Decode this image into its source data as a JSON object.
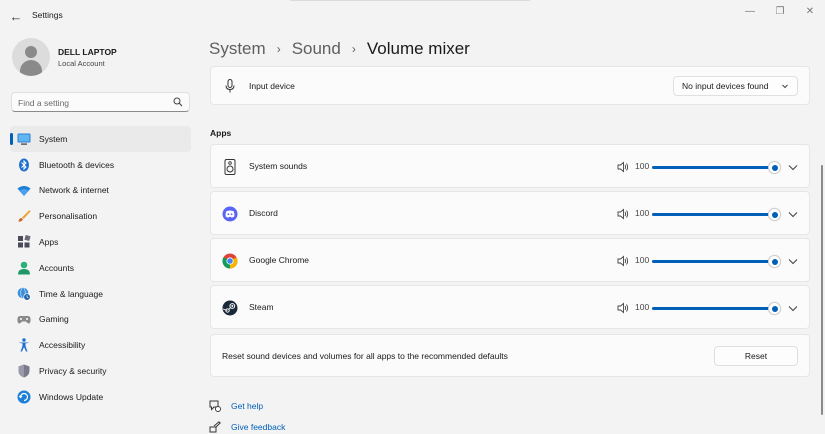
{
  "window": {
    "title": "Settings",
    "back_glyph": "←",
    "minimize_glyph": "—",
    "maximize_glyph": "❐",
    "close_glyph": "✕"
  },
  "profile": {
    "name": "DELL LAPTOP",
    "subtitle": "Local Account"
  },
  "search": {
    "placeholder": "Find a setting"
  },
  "sidebar": {
    "items": [
      {
        "label": "System",
        "icon": "system-icon",
        "active": true
      },
      {
        "label": "Bluetooth & devices",
        "icon": "bluetooth-icon"
      },
      {
        "label": "Network & internet",
        "icon": "wifi-icon"
      },
      {
        "label": "Personalisation",
        "icon": "brush-icon"
      },
      {
        "label": "Apps",
        "icon": "apps-icon"
      },
      {
        "label": "Accounts",
        "icon": "account-icon"
      },
      {
        "label": "Time & language",
        "icon": "globe-clock-icon"
      },
      {
        "label": "Gaming",
        "icon": "controller-icon"
      },
      {
        "label": "Accessibility",
        "icon": "accessibility-icon"
      },
      {
        "label": "Privacy & security",
        "icon": "shield-icon"
      },
      {
        "label": "Windows Update",
        "icon": "update-icon"
      }
    ]
  },
  "breadcrumb": {
    "part1": "System",
    "part2": "Sound",
    "current": "Volume mixer",
    "separator": "›"
  },
  "input_device": {
    "label": "Input device",
    "dropdown_value": "No input devices found"
  },
  "apps_section": {
    "title": "Apps"
  },
  "apps": [
    {
      "name": "System sounds",
      "volume": 100,
      "icon": "speaker-icon"
    },
    {
      "name": "Discord",
      "volume": 100,
      "icon": "discord-icon"
    },
    {
      "name": "Google Chrome",
      "volume": 100,
      "icon": "chrome-icon"
    },
    {
      "name": "Steam",
      "volume": 100,
      "icon": "steam-icon"
    }
  ],
  "reset": {
    "text": "Reset sound devices and volumes for all apps to the recommended defaults",
    "button_label": "Reset"
  },
  "links": {
    "help": "Get help",
    "feedback": "Give feedback"
  },
  "colors": {
    "accent": "#005fb8",
    "background": "#f3f3f3",
    "card": "#fbfbfb"
  }
}
